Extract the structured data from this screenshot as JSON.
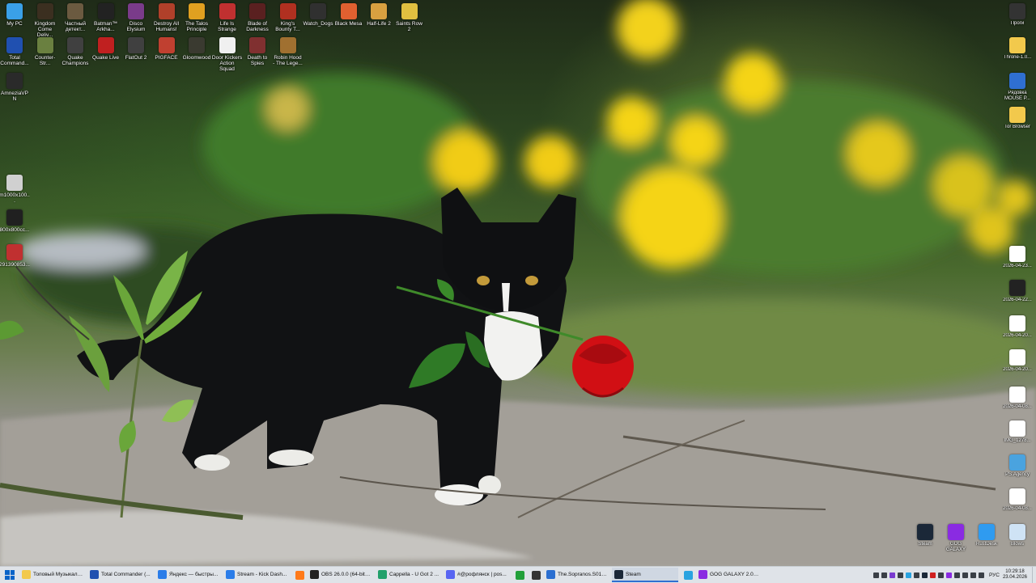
{
  "desktop_left": [
    {
      "label": "My PC",
      "icon": "computer-icon",
      "color": "#3aa0e8"
    },
    {
      "label": "Kingdom Come Deliv...",
      "icon": "game-icon",
      "color": "#3b2f20"
    },
    {
      "label": "Частный детект...",
      "icon": "game-icon",
      "color": "#6b5a40"
    },
    {
      "label": "Batman™ Arkha...",
      "icon": "game-icon",
      "color": "#222222"
    },
    {
      "label": "Disco Elysium",
      "icon": "game-icon",
      "color": "#7a3b8a"
    },
    {
      "label": "Destroy All Humans!",
      "icon": "game-icon",
      "color": "#b0402a"
    },
    {
      "label": "The Talos Principle",
      "icon": "game-icon",
      "color": "#e0a020"
    },
    {
      "label": "Life Is Strange",
      "icon": "game-icon",
      "color": "#c03030"
    },
    {
      "label": "Blade of Darkness",
      "icon": "game-icon",
      "color": "#5a2020"
    },
    {
      "label": "King's Bounty T...",
      "icon": "game-icon",
      "color": "#b03020"
    },
    {
      "label": "Watch_Dogs",
      "icon": "game-icon",
      "color": "#303030"
    },
    {
      "label": "Black Mesa",
      "icon": "game-icon",
      "color": "#e06030"
    },
    {
      "label": "Half-Life 2",
      "icon": "game-icon",
      "color": "#d8a040"
    },
    {
      "label": "Saints Row 2",
      "icon": "game-icon",
      "color": "#e0c040"
    },
    {
      "label": "Total Command...",
      "icon": "app-icon",
      "color": "#2050b0"
    },
    {
      "label": "Counter-Str...",
      "icon": "game-icon",
      "color": "#6a8040"
    },
    {
      "label": "Quake Champions",
      "icon": "game-icon",
      "color": "#404040"
    },
    {
      "label": "Quake Live",
      "icon": "game-icon",
      "color": "#c02020"
    },
    {
      "label": "FlatOut 2",
      "icon": "game-icon",
      "color": "#404040"
    },
    {
      "label": "PIGFACE",
      "icon": "game-icon",
      "color": "#c04030"
    },
    {
      "label": "Gloomwood",
      "icon": "game-icon",
      "color": "#3a3a30"
    },
    {
      "label": "Door Kickers Action Squad",
      "icon": "game-icon",
      "color": "#f0f0f0"
    },
    {
      "label": "Death to Spies",
      "icon": "game-icon",
      "color": "#803030"
    },
    {
      "label": "Robin Hood - The Lege...",
      "icon": "game-icon",
      "color": "#a07030"
    },
    {
      "label": "AmneziaVPN",
      "icon": "vpn-icon",
      "color": "#2a2a2a"
    },
    {
      "label": "m1000x100...",
      "icon": "image-file-icon",
      "color": "#d0d0d0"
    },
    {
      "label": "800x800cc...",
      "icon": "image-file-icon",
      "color": "#202020"
    },
    {
      "label": "291390853...",
      "icon": "image-file-icon",
      "color": "#c03030"
    }
  ],
  "desktop_right": [
    {
      "label": "Проги",
      "icon": "shortcut-icon",
      "color": "#333333"
    },
    {
      "label": "Throne-1.0...",
      "icon": "folder-icon",
      "color": "#f2c94c"
    },
    {
      "label": "Рядовка MOUSE P...",
      "icon": "document-icon",
      "color": "#2f6fd1"
    },
    {
      "label": "Tor Browser",
      "icon": "folder-icon",
      "color": "#f2c94c"
    },
    {
      "label": "2026-04-23...",
      "icon": "image-file-icon",
      "color": "#ffffff"
    },
    {
      "label": "2026-04-22...",
      "icon": "image-file-icon",
      "color": "#222222"
    },
    {
      "label": "2026-04-20...",
      "icon": "image-file-icon",
      "color": "#ffffff"
    },
    {
      "label": "2026-04-20...",
      "icon": "image-file-icon",
      "color": "#ffffff"
    },
    {
      "label": "2026-04-08...",
      "icon": "image-file-icon",
      "color": "#ffffff"
    },
    {
      "label": "IMG_1278...",
      "icon": "image-file-icon",
      "color": "#ffffff"
    },
    {
      "label": "PS.Agency",
      "icon": "document-icon",
      "color": "#4aa3df"
    },
    {
      "label": "2026-04-08...",
      "icon": "image-file-icon",
      "color": "#ffffff"
    },
    {
      "label": "Steam",
      "icon": "steam-icon",
      "color": "#1b2838"
    },
    {
      "label": "GOG GALAXY",
      "icon": "gog-icon",
      "color": "#8a2be2"
    },
    {
      "label": "RustDesk",
      "icon": "rustdesk-icon",
      "color": "#2f9bf0"
    },
    {
      "label": "Blows",
      "icon": "recycle-bin-icon",
      "color": "#cfe3f5"
    }
  ],
  "taskbar": {
    "items": [
      {
        "label": "Топовый Музыкальный",
        "icon": "folder-icon",
        "color": "#f2c94c",
        "active": false
      },
      {
        "label": "Total Commander (...",
        "icon": "total-commander-icon",
        "color": "#2050b0",
        "active": false
      },
      {
        "label": "Яндекс — быстры...",
        "icon": "chrome-icon",
        "color": "#2b7de9",
        "active": false
      },
      {
        "label": "Stream - Kick Dash...",
        "icon": "chrome-icon",
        "color": "#2b7de9",
        "active": false
      },
      {
        "label": "",
        "icon": "firefox-icon",
        "color": "#ff7a1a",
        "active": false
      },
      {
        "label": "OBS 26.0.0 (64-bit, ...",
        "icon": "obs-icon",
        "color": "#222222",
        "active": false
      },
      {
        "label": "Cappella - U Got 2 ...",
        "icon": "music-icon",
        "color": "#22a06b",
        "active": false
      },
      {
        "label": "#@рофлянск | pos...",
        "icon": "discord-icon",
        "color": "#5865f2",
        "active": false
      },
      {
        "label": "",
        "icon": "app-icon",
        "color": "#22a03a",
        "active": false
      },
      {
        "label": "",
        "icon": "app-icon",
        "color": "#333333",
        "active": false
      },
      {
        "label": "The.Sopranos.S01E...",
        "icon": "player-icon",
        "color": "#2b6fd1",
        "active": false
      },
      {
        "label": "Steam",
        "icon": "steam-icon",
        "color": "#1b2838",
        "active": true
      },
      {
        "label": "",
        "icon": "telegram-icon",
        "color": "#2aa3e0",
        "active": false
      },
      {
        "label": "GOG GALAXY 2.0.9...",
        "icon": "gog-icon",
        "color": "#8a2be2",
        "active": false
      }
    ],
    "lang": "РУС",
    "time": "10:29:18",
    "date": "23.04.2026"
  }
}
